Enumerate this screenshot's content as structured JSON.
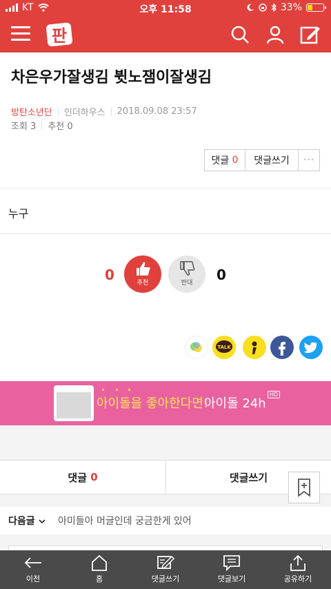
{
  "status_bar": {
    "carrier": "KT",
    "time": "오후 11:58",
    "battery": "33%",
    "battery_level": 0.33
  },
  "nav": {
    "logo_text": "판",
    "icons": [
      "menu-icon",
      "search-icon",
      "user-icon",
      "write-icon"
    ]
  },
  "article": {
    "title": "차은우가잘생김 뷧노잼이잘생김",
    "author": "방탄소년단",
    "category": "인더하우스",
    "datetime": "2018.09.08 23:57",
    "views": "조회 3",
    "recommend": "추천 0"
  },
  "actions": {
    "comment_label": "댓글",
    "comment_count": "0",
    "write_label": "댓글쓰기",
    "more": "···"
  },
  "body": {
    "text": "누구"
  },
  "vote": {
    "up_count": "0",
    "up_label": "추천",
    "down_label": "반대",
    "down_count": "0"
  },
  "share": [
    "share-icon",
    "kakaotalk-icon",
    "kakaostory-icon",
    "facebook-icon",
    "twitter-icon"
  ],
  "share_text": {
    "talk": "TALK"
  },
  "banner": {
    "text1": "아이돌을 좋아한다면!",
    "text2": "아이돌 24h",
    "hd": "HD"
  },
  "comment_bar": {
    "comment_label": "댓글",
    "comment_count": "0",
    "write_label": "댓글쓰기"
  },
  "next": {
    "label": "다음글",
    "value": "아미들아 머글인데 궁금한게 있어"
  },
  "bottom_nav": {
    "items": [
      "이전",
      "홈",
      "댓글쓰기",
      "댓글보기",
      "공유하기"
    ]
  },
  "colors": {
    "brand_red": "#e0413d",
    "banner_pink": "#e9629f",
    "bottom_bar": "#4a4a4a"
  }
}
